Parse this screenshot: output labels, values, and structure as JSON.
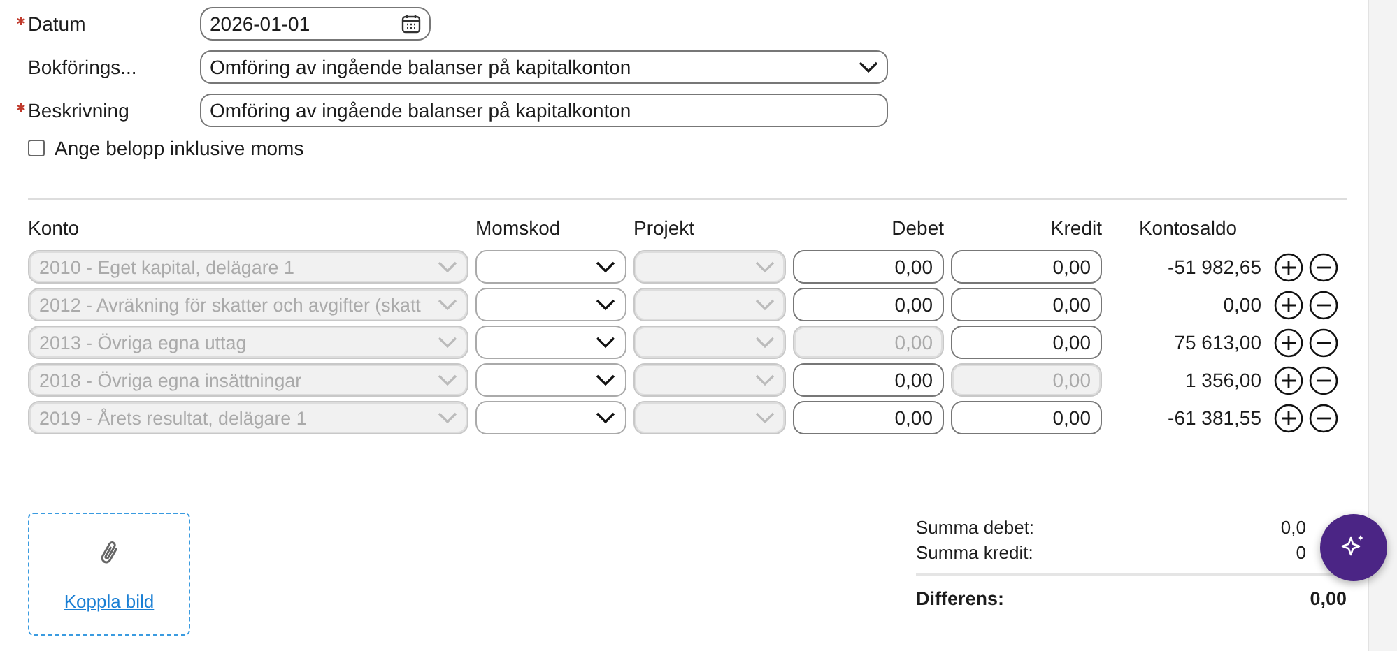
{
  "form": {
    "date": {
      "label": "Datum",
      "required": true,
      "value": "2026-01-01"
    },
    "series": {
      "label": "Bokförings...",
      "required": false,
      "value": "Omföring av ingående balanser på kapitalkonton"
    },
    "description": {
      "label": "Beskrivning",
      "required": true,
      "value": "Omföring av ingående balanser på kapitalkonton"
    },
    "vat_included": {
      "label": "Ange belopp inklusive moms",
      "checked": false
    }
  },
  "table": {
    "columns": [
      "Konto",
      "Momskod",
      "Projekt",
      "Debet",
      "Kredit",
      "Kontosaldo"
    ],
    "rows": [
      {
        "konto": "2010 - Eget kapital, delägare 1",
        "konto_disabled": true,
        "projekt_disabled": true,
        "debet": {
          "value": "0,00",
          "disabled": false
        },
        "kredit": {
          "value": "0,00",
          "disabled": false
        },
        "kontosaldo": "-51 982,65"
      },
      {
        "konto": "2012 - Avräkning för skatter och avgifter (skatt",
        "konto_disabled": true,
        "projekt_disabled": true,
        "debet": {
          "value": "0,00",
          "disabled": false
        },
        "kredit": {
          "value": "0,00",
          "disabled": false
        },
        "kontosaldo": "0,00"
      },
      {
        "konto": "2013 - Övriga egna uttag",
        "konto_disabled": true,
        "projekt_disabled": true,
        "debet": {
          "value": "0,00",
          "disabled": true
        },
        "kredit": {
          "value": "0,00",
          "disabled": false
        },
        "kontosaldo": "75 613,00"
      },
      {
        "konto": "2018 - Övriga egna insättningar",
        "konto_disabled": true,
        "projekt_disabled": true,
        "debet": {
          "value": "0,00",
          "disabled": false
        },
        "kredit": {
          "value": "0,00",
          "disabled": true
        },
        "kontosaldo": "1 356,00"
      },
      {
        "konto": "2019 - Årets resultat, delägare 1",
        "konto_disabled": true,
        "projekt_disabled": true,
        "debet": {
          "value": "0,00",
          "disabled": false
        },
        "kredit": {
          "value": "0,00",
          "disabled": false
        },
        "kontosaldo": "-61 381,55"
      }
    ]
  },
  "attachment": {
    "link": "Koppla bild"
  },
  "summary": {
    "lines": [
      {
        "label": "Summa debet:",
        "value": "0,0"
      },
      {
        "label": "Summa kredit:",
        "value": "0"
      }
    ],
    "total": {
      "label": "Differens:",
      "value": "0,00"
    }
  }
}
